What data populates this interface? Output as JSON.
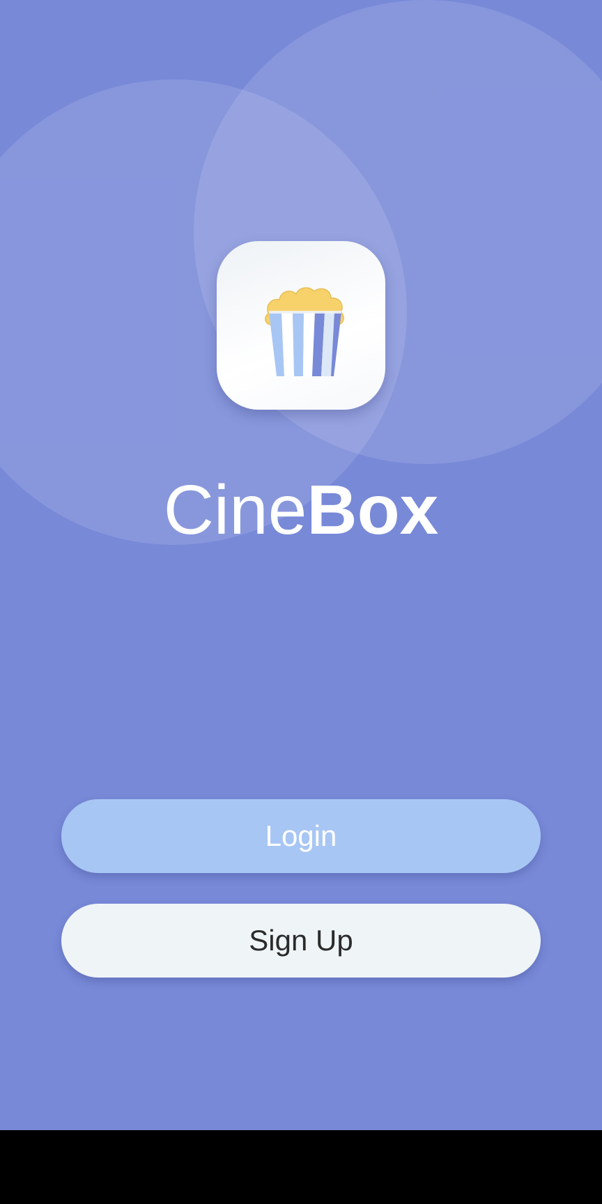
{
  "app": {
    "name_light": "Cine",
    "name_bold": "Box",
    "logo_icon": "popcorn-icon"
  },
  "actions": {
    "login_label": "Login",
    "signup_label": "Sign Up"
  },
  "colors": {
    "background": "#7889d8",
    "login_button": "#a8c6f4",
    "signup_button": "#eff4f7",
    "popcorn": "#f7d26b",
    "stripe_light": "#a8c6f4",
    "stripe_dark": "#7889d8",
    "nav_bar": "#000000"
  }
}
